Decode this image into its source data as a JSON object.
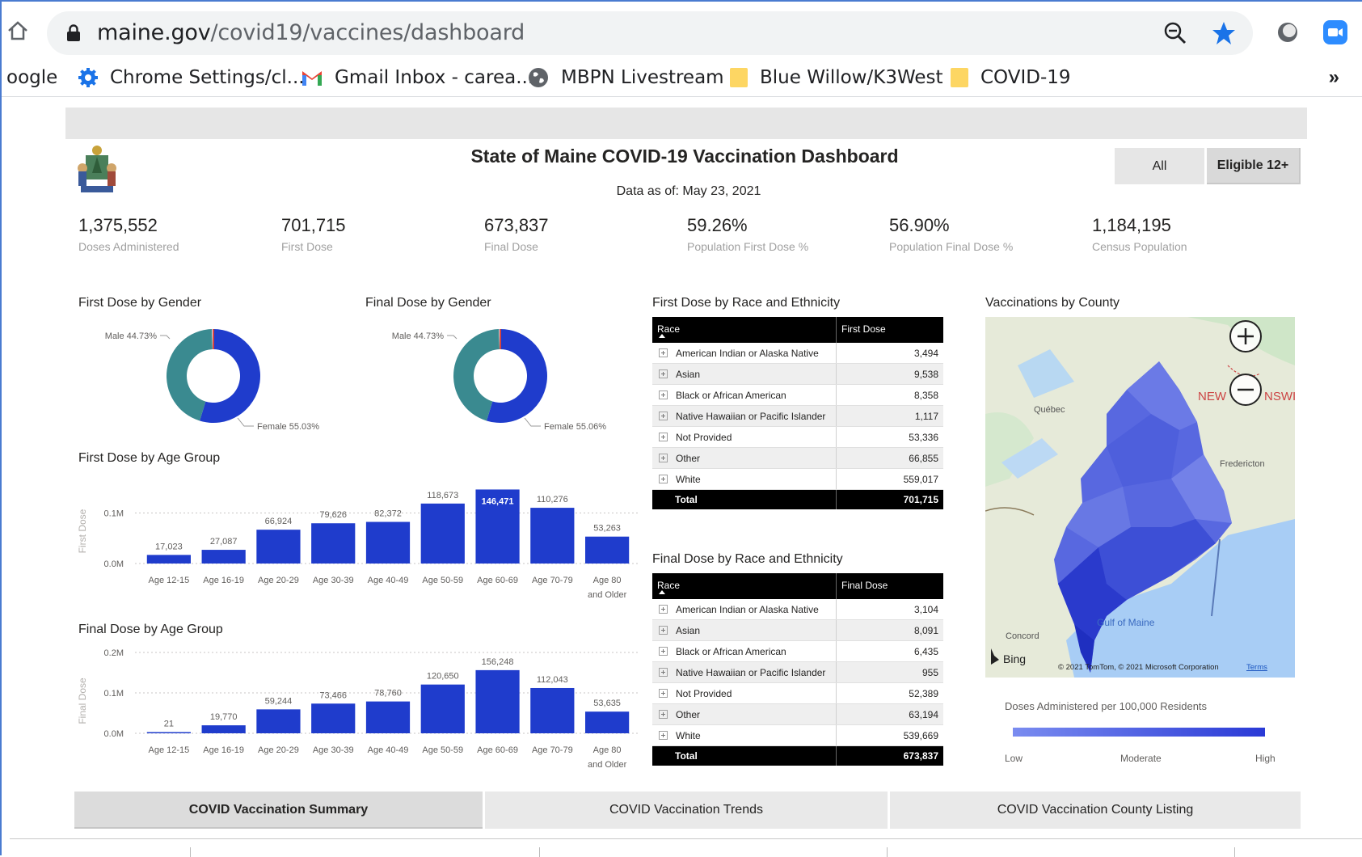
{
  "browser": {
    "url_domain": "maine.gov",
    "url_path": "/covid19/vaccines/dashboard",
    "bookmarks": [
      {
        "label": "oogle"
      },
      {
        "label": "Chrome Settings/cl..."
      },
      {
        "label": "Gmail Inbox - carea..."
      },
      {
        "label": "MBPN Livestream"
      },
      {
        "label": "Blue Willow/K3West"
      },
      {
        "label": "COVID-19"
      }
    ],
    "more_label": "»"
  },
  "dashboard": {
    "title": "State of Maine COVID-19 Vaccination Dashboard",
    "data_as_of": "Data as of: May 23, 2021",
    "filter_all": "All",
    "filter_eligible": "Eligible 12+",
    "kpis": [
      {
        "value": "1,375,552",
        "label": "Doses Administered"
      },
      {
        "value": "701,715",
        "label": "First Dose"
      },
      {
        "value": "673,837",
        "label": "Final Dose"
      },
      {
        "value": "59.26%",
        "label": "Population First Dose %"
      },
      {
        "value": "56.90%",
        "label": "Population Final Dose %"
      },
      {
        "value": "1,184,195",
        "label": "Census Population"
      }
    ],
    "titles": {
      "first_gender": "First Dose by Gender",
      "final_gender": "Final Dose by Gender",
      "first_age": "First Dose by Age Group",
      "final_age": "Final Dose by Age Group",
      "first_race": "First Dose by Race and Ethnicity",
      "final_race": "Final Dose by Race and Ethnicity",
      "county": "Vaccinations by County"
    },
    "first_race_table": {
      "col1": "Race",
      "col2": "First Dose",
      "rows": [
        {
          "race": "American Indian or Alaska Native",
          "value": "3,494"
        },
        {
          "race": "Asian",
          "value": "9,538"
        },
        {
          "race": "Black or African American",
          "value": "8,358"
        },
        {
          "race": "Native Hawaiian or Pacific Islander",
          "value": "1,117"
        },
        {
          "race": "Not Provided",
          "value": "53,336"
        },
        {
          "race": "Other",
          "value": "66,855"
        },
        {
          "race": "White",
          "value": "559,017"
        }
      ],
      "total_label": "Total",
      "total_value": "701,715"
    },
    "final_race_table": {
      "col1": "Race",
      "col2": "Final Dose",
      "rows": [
        {
          "race": "American Indian or Alaska Native",
          "value": "3,104"
        },
        {
          "race": "Asian",
          "value": "8,091"
        },
        {
          "race": "Black or African American",
          "value": "6,435"
        },
        {
          "race": "Native Hawaiian or Pacific Islander",
          "value": "955"
        },
        {
          "race": "Not Provided",
          "value": "52,389"
        },
        {
          "race": "Other",
          "value": "63,194"
        },
        {
          "race": "White",
          "value": "539,669"
        }
      ],
      "total_label": "Total",
      "total_value": "673,837"
    },
    "map": {
      "labels": [
        "Québec",
        "NEW",
        "NSWI",
        "Fredericton",
        "Gulf of Maine",
        "Concord"
      ],
      "bing": "Bing",
      "copyright": "© 2021 TomTom, © 2021 Microsoft Corporation",
      "terms": "Terms",
      "legend_title": "Doses Administered per 100,000 Residents",
      "legend_low": "Low",
      "legend_mid": "Moderate",
      "legend_high": "High"
    },
    "nav": [
      {
        "label": "COVID Vaccination Summary"
      },
      {
        "label": "COVID Vaccination Trends"
      },
      {
        "label": "COVID Vaccination County Listing"
      }
    ],
    "colors": {
      "bar": "#1f3ccc",
      "male": "#3a8a90",
      "female": "#1f3ccc",
      "accent": "#1a73e8"
    }
  },
  "chart_data": [
    {
      "type": "pie",
      "title": "First Dose by Gender",
      "categories": [
        "Male",
        "Female"
      ],
      "values": [
        44.73,
        55.03
      ],
      "labels": [
        "Male 44.73%",
        "Female 55.03%"
      ]
    },
    {
      "type": "pie",
      "title": "Final Dose by Gender",
      "categories": [
        "Male",
        "Female"
      ],
      "values": [
        44.73,
        55.06
      ],
      "labels": [
        "Male 44.73%",
        "Female 55.06%"
      ]
    },
    {
      "type": "bar",
      "title": "First Dose by Age Group",
      "ylabel": "First Dose",
      "yticks": [
        "0.1M",
        "0.0M"
      ],
      "ylim": [
        0,
        160000
      ],
      "categories": [
        "Age 12-15",
        "Age 16-19",
        "Age 20-29",
        "Age 30-39",
        "Age 40-49",
        "Age 50-59",
        "Age 60-69",
        "Age 70-79",
        "Age 80 and Older"
      ],
      "values": [
        17023,
        27087,
        66924,
        79626,
        82372,
        118673,
        146471,
        110276,
        53263
      ],
      "value_labels": [
        "17,023",
        "27,087",
        "66,924",
        "79,626",
        "82,372",
        "118,673",
        "146,471",
        "110,276",
        "53,263"
      ]
    },
    {
      "type": "bar",
      "title": "Final Dose by Age Group",
      "ylabel": "Final Dose",
      "yticks": [
        "0.2M",
        "0.1M",
        "0.0M"
      ],
      "ylim": [
        0,
        200000
      ],
      "categories": [
        "Age 12-15",
        "Age 16-19",
        "Age 20-29",
        "Age 30-39",
        "Age 40-49",
        "Age 50-59",
        "Age 60-69",
        "Age 70-79",
        "Age 80 and Older"
      ],
      "values": [
        21,
        19770,
        59244,
        73466,
        78760,
        120650,
        156248,
        112043,
        53635
      ],
      "value_labels": [
        "21",
        "19,770",
        "59,244",
        "73,466",
        "78,760",
        "120,650",
        "156,248",
        "112,043",
        "53,635"
      ]
    }
  ]
}
